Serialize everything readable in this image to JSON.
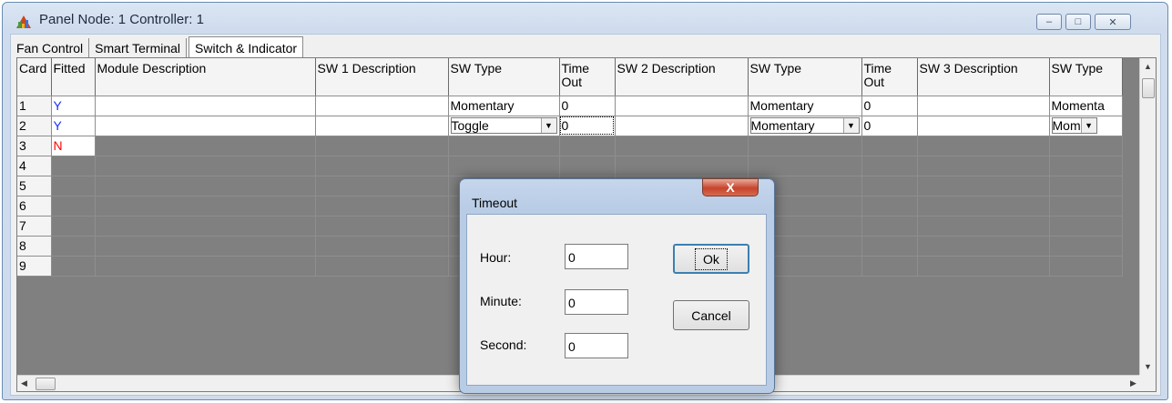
{
  "window": {
    "title": "Panel Node: 1 Controller: 1",
    "controls": {
      "minimize": "‒",
      "maximize": "□",
      "close": "✕"
    }
  },
  "tabs": [
    {
      "label": "Fan Control",
      "active": false
    },
    {
      "label": "Smart Terminal",
      "active": false
    },
    {
      "label": "Switch & Indicator",
      "active": true
    }
  ],
  "grid": {
    "columns": [
      "Card",
      "Fitted",
      "Module Description",
      "SW 1 Description",
      "SW Type",
      "Time Out",
      "SW 2 Description",
      "SW Type",
      "Time Out",
      "SW 3 Description",
      "SW Type"
    ],
    "rows": [
      {
        "card": "1",
        "fitted": "Y",
        "module": "",
        "sw1_desc": "",
        "sw1_type": "Momentary",
        "sw1_timeout": "0",
        "sw2_desc": "",
        "sw2_type": "Momentary",
        "sw2_timeout": "0",
        "sw3_desc": "",
        "sw3_type": "Momenta"
      },
      {
        "card": "2",
        "fitted": "Y",
        "module": "",
        "sw1_desc": "",
        "sw1_type": "Toggle",
        "sw1_timeout": "0",
        "sw2_desc": "",
        "sw2_type": "Momentary",
        "sw2_timeout": "0",
        "sw3_desc": "",
        "sw3_type": "Mom"
      },
      {
        "card": "3",
        "fitted": "N"
      },
      {
        "card": "4"
      },
      {
        "card": "5"
      },
      {
        "card": "6"
      },
      {
        "card": "7"
      },
      {
        "card": "8"
      },
      {
        "card": "9"
      }
    ]
  },
  "dialog": {
    "title": "Timeout",
    "close_label": "X",
    "hour_label": "Hour:",
    "hour_value": "0",
    "minute_label": "Minute:",
    "minute_value": "0",
    "second_label": "Second:",
    "second_value": "0",
    "ok_label": "Ok",
    "cancel_label": "Cancel"
  },
  "colors": {
    "fitted_yes": "#1a2fff",
    "fitted_no": "#ff0000",
    "inactive_cell": "#808080"
  },
  "icons": [
    "panel-app-icon",
    "dropdown-arrow-icon",
    "scroll-up-icon",
    "scroll-down-icon",
    "scroll-left-icon",
    "scroll-right-icon"
  ]
}
